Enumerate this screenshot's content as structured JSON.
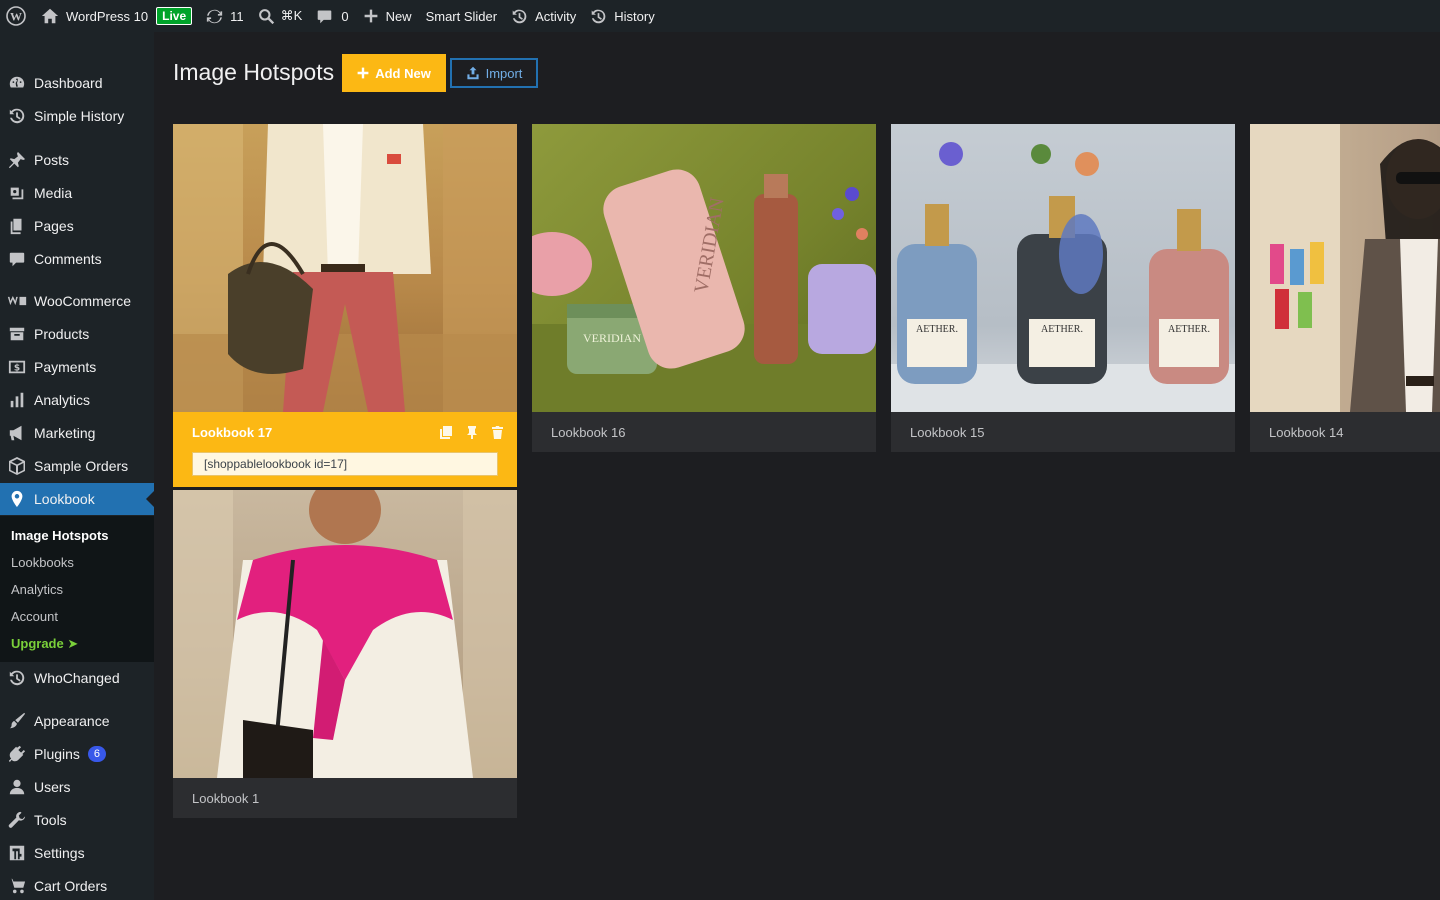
{
  "adminbar": {
    "site_name": "WordPress 10",
    "live_label": "Live",
    "updates_count": "11",
    "search_shortcut": "⌘K",
    "comments_count": "0",
    "new_label": "New",
    "smart_slider_label": "Smart Slider",
    "activity_label": "Activity",
    "history_label": "History"
  },
  "sidebar": {
    "items": [
      {
        "label": "Dashboard",
        "icon": "dashboard-icon"
      },
      {
        "label": "Simple History",
        "icon": "history-icon"
      },
      {
        "label": "Posts",
        "icon": "pin-icon"
      },
      {
        "label": "Media",
        "icon": "media-icon"
      },
      {
        "label": "Pages",
        "icon": "pages-icon"
      },
      {
        "label": "Comments",
        "icon": "comment-icon"
      },
      {
        "label": "WooCommerce",
        "icon": "woocommerce-icon"
      },
      {
        "label": "Products",
        "icon": "archive-icon"
      },
      {
        "label": "Payments",
        "icon": "payments-icon"
      },
      {
        "label": "Analytics",
        "icon": "chart-icon"
      },
      {
        "label": "Marketing",
        "icon": "megaphone-icon"
      },
      {
        "label": "Sample Orders",
        "icon": "box-icon"
      },
      {
        "label": "Lookbook",
        "icon": "location-pin-icon"
      },
      {
        "label": "WhoChanged",
        "icon": "history-icon"
      },
      {
        "label": "Appearance",
        "icon": "paintbrush-icon"
      },
      {
        "label": "Plugins",
        "icon": "plugin-icon",
        "badge": "6"
      },
      {
        "label": "Users",
        "icon": "user-icon"
      },
      {
        "label": "Tools",
        "icon": "wrench-icon"
      },
      {
        "label": "Settings",
        "icon": "settings-icon"
      },
      {
        "label": "Cart Orders",
        "icon": "cart-icon"
      }
    ],
    "submenu": [
      "Image Hotspots",
      "Lookbooks",
      "Analytics",
      "Account",
      "Upgrade ➤"
    ]
  },
  "header": {
    "title": "Image Hotspots",
    "add_new_label": "Add New",
    "import_label": "Import"
  },
  "cards": [
    {
      "title": "Lookbook 17",
      "shortcode": "[shoppablelookbook id=17]"
    },
    {
      "title": "Lookbook 16"
    },
    {
      "title": "Lookbook 15"
    },
    {
      "title": "Lookbook 14"
    },
    {
      "title": "Lookbook 1"
    }
  ],
  "colors": {
    "accent": "#fcb814",
    "active_menu": "#2271b1",
    "background": "#1d1e21",
    "adminbar": "#1d2327"
  }
}
